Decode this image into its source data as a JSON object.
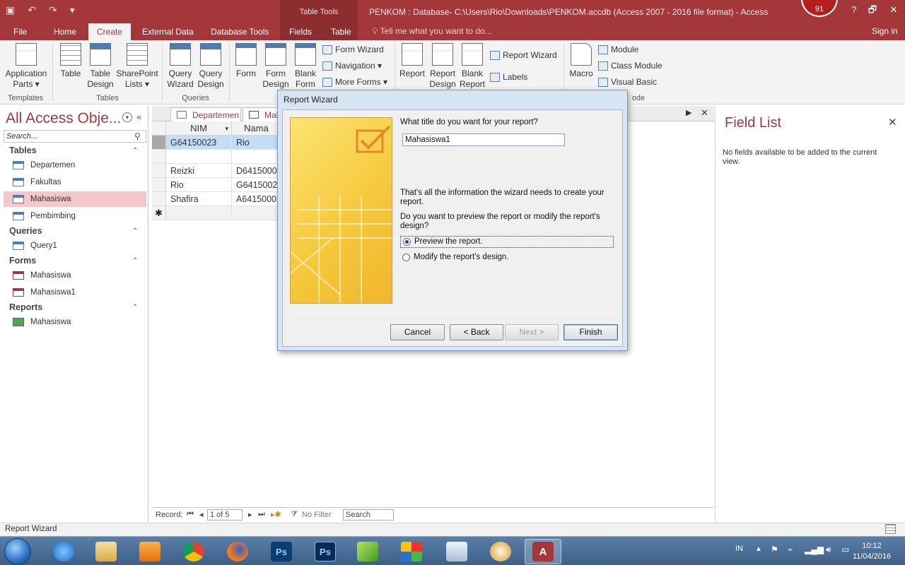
{
  "window": {
    "title": "PENKOM : Database- C:\\Users\\Rio\\Downloads\\PENKOM.accdb (Access 2007 - 2016 file format) - Access",
    "contextual_header": "Table Tools",
    "user_badge": "91",
    "controls": {
      "help": "?",
      "minimize": "—",
      "restore": "🗗",
      "close": "✕"
    }
  },
  "quick_access": {
    "save_icon": "▣",
    "undo_icon": "↶",
    "redo_icon": "↷",
    "customize_icon": "▾"
  },
  "tabs": {
    "file": "File",
    "home": "Home",
    "create": "Create",
    "external": "External Data",
    "dbtools": "Database Tools",
    "fields": "Fields",
    "table": "Table",
    "tellme": "Tell me what you want to do...",
    "signin": "Sign in"
  },
  "ribbon": {
    "templates": {
      "app_parts": "Application",
      "app_parts_2": "Parts ▾",
      "group": "Templates"
    },
    "tables": {
      "table": "Table",
      "table_design": "Table",
      "table_design_2": "Design",
      "sharepoint": "SharePoint",
      "sharepoint_2": "Lists ▾",
      "group": "Tables"
    },
    "queries": {
      "wizard": "Query",
      "wizard_2": "Wizard",
      "design": "Query",
      "design_2": "Design",
      "group": "Queries"
    },
    "forms": {
      "form": "Form",
      "form_design": "Form",
      "form_design_2": "Design",
      "blank": "Blank",
      "blank_2": "Form",
      "form_wizard": "Form Wizard",
      "navigation": "Navigation ▾",
      "more_forms": "More Forms ▾"
    },
    "reports": {
      "report": "Report",
      "report_design": "Report",
      "report_design_2": "Design",
      "blank": "Blank",
      "blank_2": "Report",
      "report_wizard": "Report Wizard",
      "labels": "Labels"
    },
    "macros": {
      "macro": "Macro",
      "module": "Module",
      "class_module": "Class Module",
      "visual_basic": "Visual Basic",
      "group_tail": "ode"
    }
  },
  "nav": {
    "title": "All Access Obje...",
    "search_placeholder": "Search...",
    "groups": [
      {
        "label": "Tables",
        "items": [
          "Departemen",
          "Fakultas",
          "Mahasiswa",
          "Pembimbing"
        ]
      },
      {
        "label": "Queries",
        "items": [
          "Query1"
        ]
      },
      {
        "label": "Forms",
        "items": [
          "Mahasiswa",
          "Mahasiswa1"
        ]
      },
      {
        "label": "Reports",
        "items": [
          "Mahasiswa"
        ]
      }
    ]
  },
  "doctabs": {
    "tab1": "Departemen",
    "tab2": "Mah"
  },
  "datasheet": {
    "columns": [
      "NIM",
      "Nama"
    ],
    "rows": [
      [
        "G64150023",
        "Rio"
      ],
      [
        "",
        ""
      ],
      [
        "Reizki",
        "D641500011"
      ],
      [
        "Rio",
        "G641500231"
      ],
      [
        "Shafira",
        "A641500021"
      ]
    ],
    "new_row_marker": "✱"
  },
  "record_nav": {
    "label": "Record:",
    "position": "1 of 5",
    "filter": "No Filter",
    "search": "Search"
  },
  "field_list": {
    "title": "Field List",
    "message": "No fields available to be added to the current view."
  },
  "status_bar": {
    "text": "Report Wizard"
  },
  "dialog": {
    "title": "Report Wizard",
    "title_prompt": "What title do you want for your report?",
    "title_value": "Mahasiswa1",
    "info": "That's all the information the wizard needs to create your report.",
    "question": "Do you want to preview the report or modify the report's design?",
    "option_preview": "Preview the report.",
    "option_modify": "Modify the report's design.",
    "selected_option": "preview",
    "buttons": {
      "cancel": "Cancel",
      "back": "< Back",
      "next": "Next >",
      "finish": "Finish"
    }
  },
  "taskbar": {
    "lang": "IN",
    "time": "10:12",
    "date": "11/04/2016",
    "apps": [
      "internet-explorer",
      "file-explorer",
      "media-player",
      "chrome",
      "firefox",
      "photoshop",
      "photoshop-cs",
      "corel",
      "paint",
      "keyboard",
      "paint-brush",
      "access"
    ]
  },
  "colors": {
    "accent": "#a4373a",
    "selected_row": "#f6c7c9",
    "wizard_yellow": "#f6c93c"
  }
}
